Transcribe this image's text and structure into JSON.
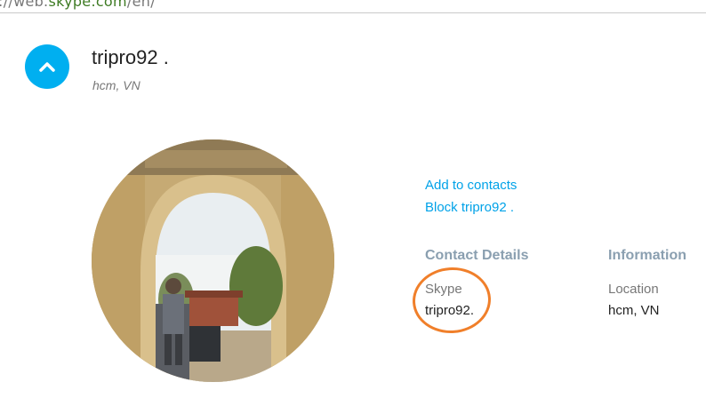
{
  "browser": {
    "url_prefix": "://web.",
    "url_domain": "skype.com",
    "url_suffix": "/en/"
  },
  "profile": {
    "name": "tripro92 .",
    "location": "hcm, VN",
    "collapse_icon": "chevron-up-icon"
  },
  "actions": {
    "add_to_contacts": "Add to contacts",
    "block": "Block tripro92 ."
  },
  "contact_details": {
    "heading": "Contact Details",
    "skype_label": "Skype",
    "skype_value": "tripro92."
  },
  "information": {
    "heading": "Information",
    "location_label": "Location",
    "location_value": "hcm, VN"
  },
  "colors": {
    "accent": "#00aff0",
    "link": "#00a2e8",
    "heading": "#8a9fb0",
    "annotation": "#f07f2a"
  }
}
